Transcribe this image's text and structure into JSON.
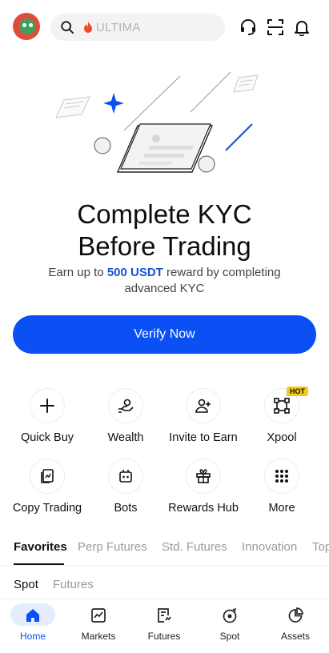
{
  "header": {
    "search_placeholder": "ULTIMA"
  },
  "kyc": {
    "title_line1": "Complete KYC",
    "title_line2": "Before Trading",
    "subtitle_pre": "Earn up to ",
    "subtitle_highlight": "500 USDT",
    "subtitle_post": " reward by completing advanced KYC",
    "verify_label": "Verify Now"
  },
  "shortcuts": [
    {
      "label": "Quick Buy",
      "icon": "plus-icon"
    },
    {
      "label": "Wealth",
      "icon": "hand-coin-icon"
    },
    {
      "label": "Invite to Earn",
      "icon": "add-user-icon"
    },
    {
      "label": "Xpool",
      "icon": "xpool-icon",
      "badge": "HOT"
    },
    {
      "label": "Copy Trading",
      "icon": "copy-trading-icon"
    },
    {
      "label": "Bots",
      "icon": "bot-icon"
    },
    {
      "label": "Rewards Hub",
      "icon": "gift-icon"
    },
    {
      "label": "More",
      "icon": "grid-dots-icon"
    }
  ],
  "market_tabs": [
    "Favorites",
    "Perp Futures",
    "Std. Futures",
    "Innovation",
    "Top"
  ],
  "market_subtabs": [
    "Spot",
    "Futures"
  ],
  "bottom_nav": [
    "Home",
    "Markets",
    "Futures",
    "Spot",
    "Assets"
  ],
  "colors": {
    "accent": "#0b50f5",
    "hot_badge": "#f7c81c",
    "highlight": "#1452d8"
  }
}
